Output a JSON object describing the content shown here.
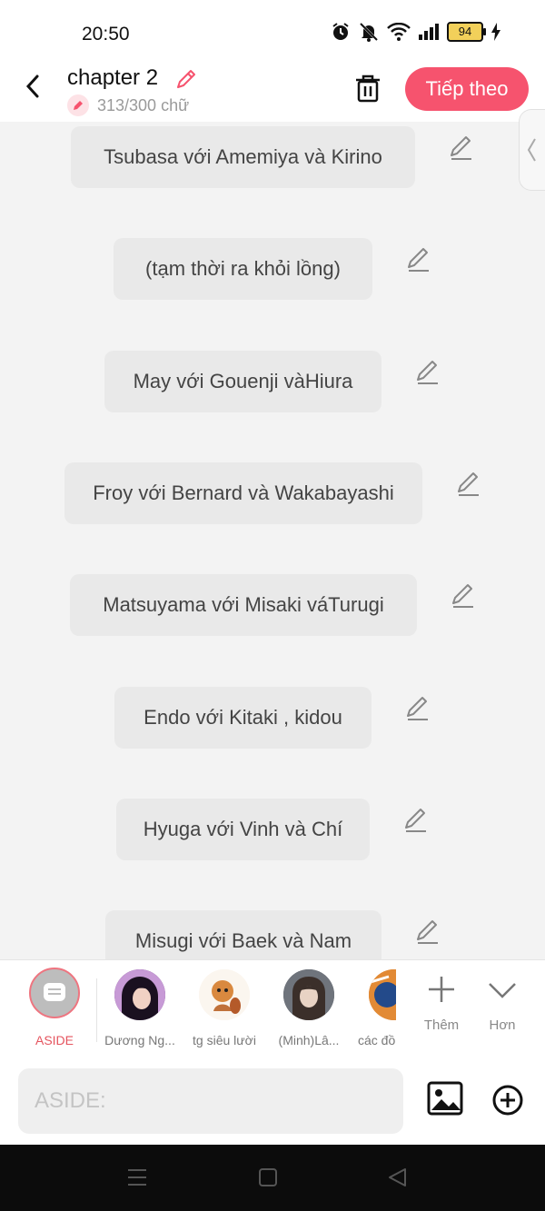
{
  "status": {
    "time": "20:50",
    "battery": "94"
  },
  "header": {
    "title": "chapter 2",
    "word_count": "313/300 chữ",
    "next_label": "Tiếp theo"
  },
  "messages": [
    "Tsubasa với Amemiya và Kirino",
    "(tạm thời ra khỏi lồng)",
    "May với Gouenji vàHiura",
    "Froy với Bernard và Wakabayashi",
    "Matsuyama với Misaki váTurugi",
    "Endo với Kitaki , kidou",
    "Hyuga với Vinh và Chí",
    "Misugi với Baek và Nam"
  ],
  "characters": {
    "aside": "ASIDE",
    "c1": "Dương Ng...",
    "c2": "tg siêu lười",
    "c3": "(Minh)Lâ...",
    "c4": "các đồ"
  },
  "tools": {
    "add_label": "Thêm",
    "more_label": "Hơn"
  },
  "input": {
    "placeholder": "ASIDE:"
  },
  "colors": {
    "accent": "#f6536e",
    "bubble": "#e9e9e9",
    "background": "#f3f3f3"
  }
}
